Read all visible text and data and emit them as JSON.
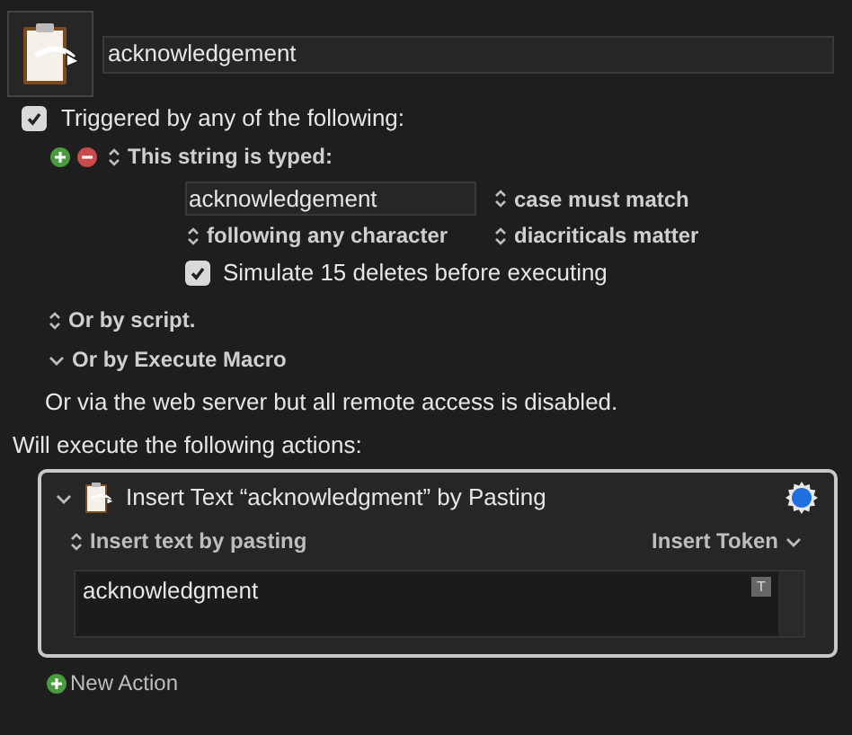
{
  "macro": {
    "name": "acknowledgement"
  },
  "triggers": {
    "label": "Triggered by any of the following:",
    "checked": true,
    "string_trigger": {
      "title": "This string is typed:",
      "typed": "acknowledgement",
      "case_option": "case must match",
      "position_option": "following any character",
      "diacritics_option": "diacriticals matter",
      "simulate": {
        "label": "Simulate 15 deletes before executing",
        "checked": true
      }
    },
    "others": [
      {
        "kind": "popup",
        "label": "Or by script."
      },
      {
        "kind": "disclosure",
        "label": "Or by Execute Macro"
      }
    ],
    "web_note": "Or via the web server but all remote access is disabled."
  },
  "actions_heading": "Will execute the following actions:",
  "actions": [
    {
      "title": "Insert Text “acknowledgment” by Pasting",
      "expanded": true,
      "mode": "Insert text by pasting",
      "token_menu": "Insert Token",
      "text": "acknowledgment",
      "token_button": "T"
    }
  ],
  "new_action": "New Action"
}
